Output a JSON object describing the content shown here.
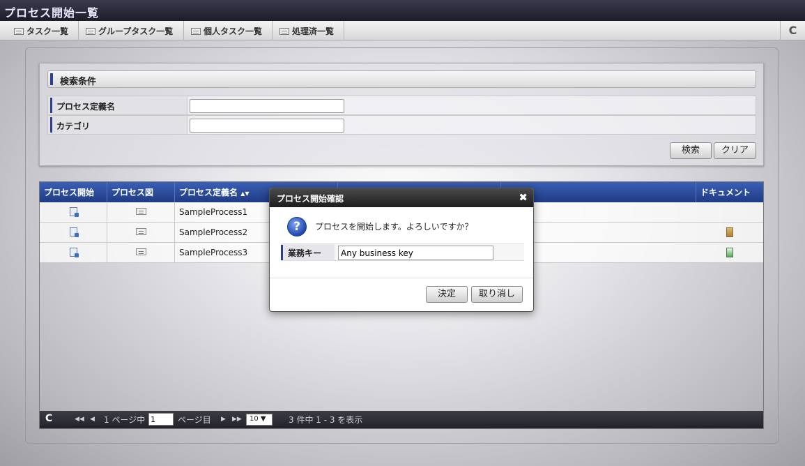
{
  "window": {
    "title": "プロセス開始一覧"
  },
  "tabs": [
    {
      "label": "タスク一覧"
    },
    {
      "label": "グループタスク一覧"
    },
    {
      "label": "個人タスク一覧"
    },
    {
      "label": "処理済一覧"
    }
  ],
  "toolbar": {
    "refresh_icon": "C"
  },
  "search": {
    "title": "検索条件",
    "fields": [
      {
        "label": "プロセス定義名",
        "value": ""
      },
      {
        "label": "カテゴリ",
        "value": ""
      }
    ],
    "search_label": "検索",
    "clear_label": "クリア"
  },
  "grid": {
    "columns": [
      "プロセス開始",
      "プロセス図",
      "プロセス定義名",
      "",
      "",
      "ドキュメント"
    ],
    "sort_indicator": "▲▼",
    "rows": [
      {
        "name": "SampleProcess1"
      },
      {
        "name": "SampleProcess2"
      },
      {
        "name": "SampleProcess3"
      }
    ],
    "pager": {
      "refresh": "C",
      "first": "◀◀",
      "prev": "◀",
      "page_prefix": "1 ページ中",
      "page_value": "1",
      "page_suffix": "ページ目",
      "next": "▶",
      "last": "▶▶",
      "page_size": "10 ▼",
      "summary": "3 件中 1 - 3 を表示"
    }
  },
  "dialog": {
    "title": "プロセス開始確認",
    "close": "✖",
    "question_icon": "?",
    "message": "プロセスを開始します。よろしいですか？",
    "field_label": "業務キー",
    "field_value": "Any business key",
    "ok_label": "決定",
    "cancel_label": "取り消し"
  }
}
